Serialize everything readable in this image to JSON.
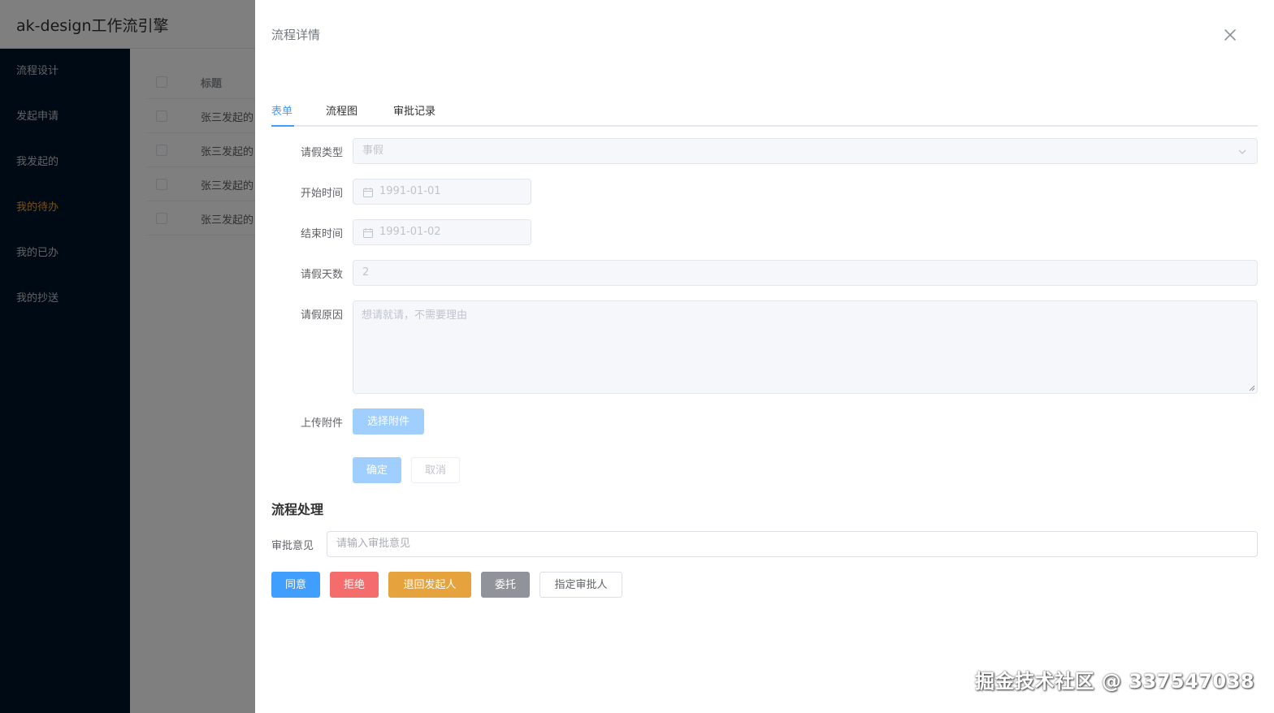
{
  "app": {
    "title": "ak-design工作流引擎",
    "menu": [
      "流程设计",
      "发起申请",
      "我发起的",
      "我的待办",
      "我的已办",
      "我的抄送"
    ],
    "active_menu": "我的待办",
    "table": {
      "header": "标题",
      "rows": [
        "张三发起的",
        "张三发起的",
        "张三发起的",
        "张三发起的"
      ]
    }
  },
  "drawer": {
    "title": "流程详情",
    "tabs": [
      "表单",
      "流程图",
      "审批记录"
    ],
    "active_tab": "表单",
    "form": {
      "leave_type_label": "请假类型",
      "leave_type_value": "事假",
      "start_label": "开始时间",
      "start_value": "1991-01-01",
      "end_label": "结束时间",
      "end_value": "1991-01-02",
      "days_label": "请假天数",
      "days_value": "2",
      "reason_label": "请假原因",
      "reason_value": "想请就请，不需要理由",
      "upload_label": "上传附件",
      "upload_button": "选择附件",
      "confirm_button": "确定",
      "cancel_button": "取消"
    },
    "process": {
      "title": "流程处理",
      "opinion_label": "审批意见",
      "opinion_placeholder": "请输入审批意见",
      "buttons": {
        "agree": "同意",
        "reject": "拒绝",
        "return": "退回发起人",
        "delegate": "委托",
        "assign": "指定审批人"
      }
    }
  },
  "watermark": "掘金技术社区 @ 337547038",
  "colors": {
    "primary": "#409eff",
    "danger": "#f56c6c",
    "warning": "#e6a23c",
    "info": "#909399",
    "sidebar": "#001529",
    "active_menu": "#e6a23c"
  },
  "icons": [
    "close-icon",
    "chevron-down-icon",
    "calendar-icon",
    "resize-grip-icon"
  ]
}
